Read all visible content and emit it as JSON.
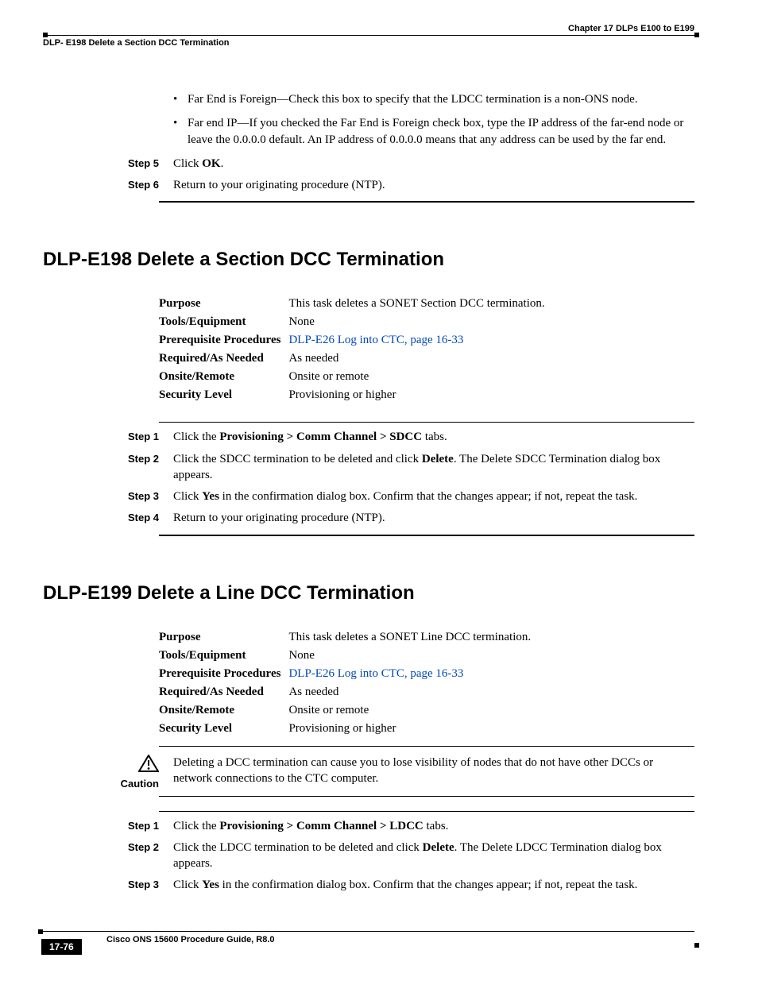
{
  "header": {
    "chapter": "Chapter 17      DLPs E100 to E199",
    "section": "DLP- E198 Delete a Section DCC Termination"
  },
  "intro_bullets": [
    "Far End is Foreign—Check this box to specify that the LDCC termination is a non-ONS node.",
    "Far end IP—If you checked the Far End is Foreign check box, type the IP address of the far-end node or leave the 0.0.0.0 default. An IP address of 0.0.0.0 means that any address can be used by the far end."
  ],
  "intro_steps": {
    "s5_label": "Step 5",
    "s5_pre": "Click ",
    "s5_b": "OK",
    "s5_post": ".",
    "s6_label": "Step 6",
    "s6_text": "Return to your originating procedure (NTP)."
  },
  "e198": {
    "title": "DLP-E198 Delete a Section DCC Termination",
    "meta": {
      "purpose_k": "Purpose",
      "purpose_v": "This task deletes a SONET Section DCC termination.",
      "tools_k": "Tools/Equipment",
      "tools_v": "None",
      "prereq_k": "Prerequisite Procedures",
      "prereq_link": "DLP-E26 Log into CTC, page 16-33",
      "req_k": "Required/As Needed",
      "req_v": "As needed",
      "onsite_k": "Onsite/Remote",
      "onsite_v": "Onsite or remote",
      "sec_k": "Security Level",
      "sec_v": "Provisioning or higher"
    },
    "steps": {
      "s1_label": "Step 1",
      "s1_pre": "Click the ",
      "s1_b": "Provisioning > Comm Channel > SDCC",
      "s1_post": " tabs.",
      "s2_label": "Step 2",
      "s2_pre": "Click the SDCC termination to be deleted and click ",
      "s2_b": "Delete",
      "s2_post": ". The Delete SDCC Termination dialog box appears.",
      "s3_label": "Step 3",
      "s3_pre": "Click ",
      "s3_b": "Yes",
      "s3_post": " in the confirmation dialog box. Confirm that the changes appear; if not, repeat the task.",
      "s4_label": "Step 4",
      "s4_text": "Return to your originating procedure (NTP)."
    }
  },
  "e199": {
    "title": "DLP-E199 Delete a Line DCC Termination",
    "meta": {
      "purpose_k": "Purpose",
      "purpose_v": "This task deletes a SONET Line DCC termination.",
      "tools_k": "Tools/Equipment",
      "tools_v": "None",
      "prereq_k": "Prerequisite Procedures",
      "prereq_link": "DLP-E26 Log into CTC, page 16-33",
      "req_k": "Required/As Needed",
      "req_v": "As needed",
      "onsite_k": "Onsite/Remote",
      "onsite_v": "Onsite or remote",
      "sec_k": "Security Level",
      "sec_v": "Provisioning or higher"
    },
    "caution_label": "Caution",
    "caution_text": "Deleting a DCC termination can cause you to lose visibility of nodes that do not have other DCCs or network connections to the CTC computer.",
    "steps": {
      "s1_label": "Step 1",
      "s1_pre": "Click the ",
      "s1_b": "Provisioning > Comm Channel > LDCC",
      "s1_post": " tabs.",
      "s2_label": "Step 2",
      "s2_pre": "Click the LDCC termination to be deleted and click ",
      "s2_b": "Delete",
      "s2_post": ". The Delete LDCC Termination dialog box appears.",
      "s3_label": "Step 3",
      "s3_pre": "Click ",
      "s3_b": "Yes",
      "s3_post": " in the confirmation dialog box. Confirm that the changes appear; if not, repeat the task."
    }
  },
  "footer": {
    "book": "Cisco ONS 15600 Procedure Guide, R8.0",
    "page": "17-76"
  }
}
